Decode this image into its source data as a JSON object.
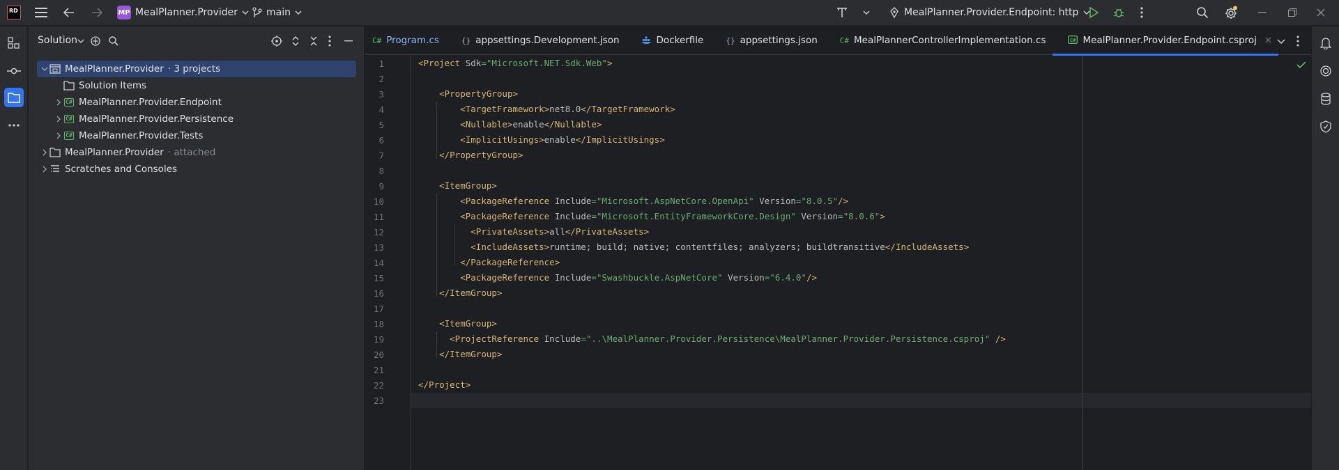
{
  "titlebar": {
    "logo": "RD",
    "project_badge": "MP",
    "project_name": "MealPlanner.Provider",
    "branch": "main",
    "run_config": "MealPlanner.Provider.Endpoint: http"
  },
  "panel": {
    "title": "Solution",
    "tree": [
      {
        "label": "MealPlanner.Provider",
        "suffix": "· 3 projects",
        "icon": "solution-icon",
        "expanded": true,
        "selected": true,
        "indent": 0
      },
      {
        "label": "Solution Items",
        "suffix": "",
        "icon": "folder-icon",
        "expanded": null,
        "indent": 1
      },
      {
        "label": "MealPlanner.Provider.Endpoint",
        "suffix": "",
        "icon": "csharp-project-icon",
        "expanded": false,
        "indent": 1
      },
      {
        "label": "MealPlanner.Provider.Persistence",
        "suffix": "",
        "icon": "csharp-project-icon",
        "expanded": false,
        "indent": 1
      },
      {
        "label": "MealPlanner.Provider.Tests",
        "suffix": "",
        "icon": "csharp-project-icon",
        "expanded": false,
        "indent": 1
      },
      {
        "label": "MealPlanner.Provider",
        "suffix": "· attached",
        "icon": "folder-icon",
        "expanded": false,
        "indent": 0
      },
      {
        "label": "Scratches and Consoles",
        "suffix": "",
        "icon": "scratches-icon",
        "expanded": false,
        "indent": 0
      }
    ]
  },
  "editor": {
    "tabs": [
      {
        "label": "Program.cs",
        "icon": "C#",
        "active": false
      },
      {
        "label": "appsettings.Development.json",
        "icon": "{}",
        "active": false
      },
      {
        "label": "Dockerfile",
        "icon": "docker",
        "active": false
      },
      {
        "label": "appsettings.json",
        "icon": "{}",
        "active": false
      },
      {
        "label": "MealPlannerControllerImplementation.cs",
        "icon": "C#",
        "active": false
      },
      {
        "label": "MealPlanner.Provider.Endpoint.csproj",
        "icon": "csproj",
        "active": true
      }
    ],
    "line_numbers": [
      "1",
      "2",
      "3",
      "4",
      "5",
      "6",
      "7",
      "8",
      "9",
      "10",
      "11",
      "12",
      "13",
      "14",
      "15",
      "16",
      "17",
      "18",
      "19",
      "20",
      "21",
      "22",
      "23"
    ],
    "lines": [
      "<Project Sdk=\"Microsoft.NET.Sdk.Web\">",
      "",
      "    <PropertyGroup>",
      "        <TargetFramework>net8.0</TargetFramework>",
      "        <Nullable>enable</Nullable>",
      "        <ImplicitUsings>enable</ImplicitUsings>",
      "    </PropertyGroup>",
      "",
      "    <ItemGroup>",
      "        <PackageReference Include=\"Microsoft.AspNetCore.OpenApi\" Version=\"8.0.5\"/>",
      "        <PackageReference Include=\"Microsoft.EntityFrameworkCore.Design\" Version=\"8.0.6\">",
      "          <PrivateAssets>all</PrivateAssets>",
      "          <IncludeAssets>runtime; build; native; contentfiles; analyzers; buildtransitive</IncludeAssets>",
      "        </PackageReference>",
      "        <PackageReference Include=\"Swashbuckle.AspNetCore\" Version=\"6.4.0\"/>",
      "    </ItemGroup>",
      "",
      "    <ItemGroup>",
      "      <ProjectReference Include=\"..\\MealPlanner.Provider.Persistence\\MealPlanner.Provider.Persistence.csproj\" />",
      "    </ItemGroup>",
      "",
      "</Project>",
      ""
    ]
  },
  "colors": {
    "accent": "#3574f0",
    "selection": "#2e436e",
    "tag": "#d5b778",
    "string": "#6aab73",
    "attr": "#bcbec4",
    "success": "#5fb865"
  }
}
